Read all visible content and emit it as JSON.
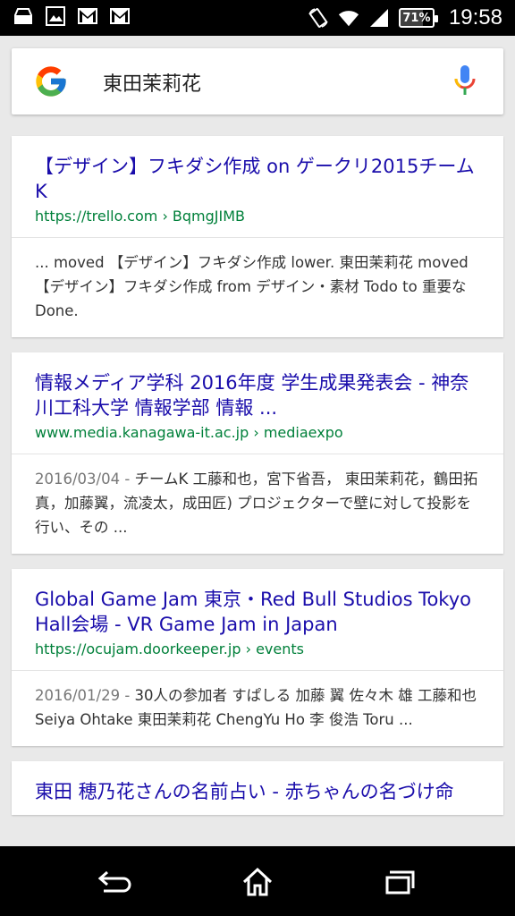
{
  "status_bar": {
    "battery": "71%",
    "battery_level": 0.71,
    "time": "19:58",
    "left_icons": [
      "tray-icon",
      "image-icon",
      "gmail-icon",
      "gmail-icon"
    ],
    "right_icons": [
      "screen-rotate-icon",
      "wifi-icon",
      "signal-icon"
    ]
  },
  "search": {
    "query": "東田茉莉花",
    "logo_icon": "google-g-icon",
    "mic_icon": "mic-icon"
  },
  "results": [
    {
      "title": "【デザイン】フキダシ作成 on ゲークリ2015チームK",
      "url": "https://trello.com › BqmgJIMB",
      "date": "",
      "snippet": "... moved 【デザイン】フキダシ作成 lower. 東田茉莉花 moved 【デザイン】フキダシ作成 from デザイン・素材 Todo to 重要なDone."
    },
    {
      "title": "情報メディア学科 2016年度 学生成果発表会 - 神奈川工科大学 情報学部 情報 ...",
      "url": "www.media.kanagawa-it.ac.jp › mediaexpo",
      "date": "2016/03/04 - ",
      "snippet": "チームK 工藤和也，宮下省吾， 東田茉莉花，鶴田拓真，加藤翼，流凌太，成田匠) プロジェクターで壁に対して投影を行い、その ..."
    },
    {
      "title": "Global Game Jam 東京・Red Bull Studios Tokyo Hall会場 - VR Game Jam in Japan",
      "url": "https://ocujam.doorkeeper.jp › events",
      "date": "2016/01/29 - ",
      "snippet": "30人の参加者 すぱしる 加藤 翼 佐々木 雄 工藤和也 Seiya Ohtake 東田茉莉花 ChengYu Ho 李 俊浩 Toru ..."
    },
    {
      "title": "東田 穂乃花さんの名前占い - 赤ちゃんの名づけ命",
      "url": "",
      "date": "",
      "snippet": ""
    }
  ],
  "nav_bar": {
    "back_icon": "back-icon",
    "home_icon": "home-icon",
    "recents_icon": "recents-icon"
  },
  "colors": {
    "link": "#1a0dab",
    "url": "#00803a",
    "background": "#e9e9e9"
  }
}
